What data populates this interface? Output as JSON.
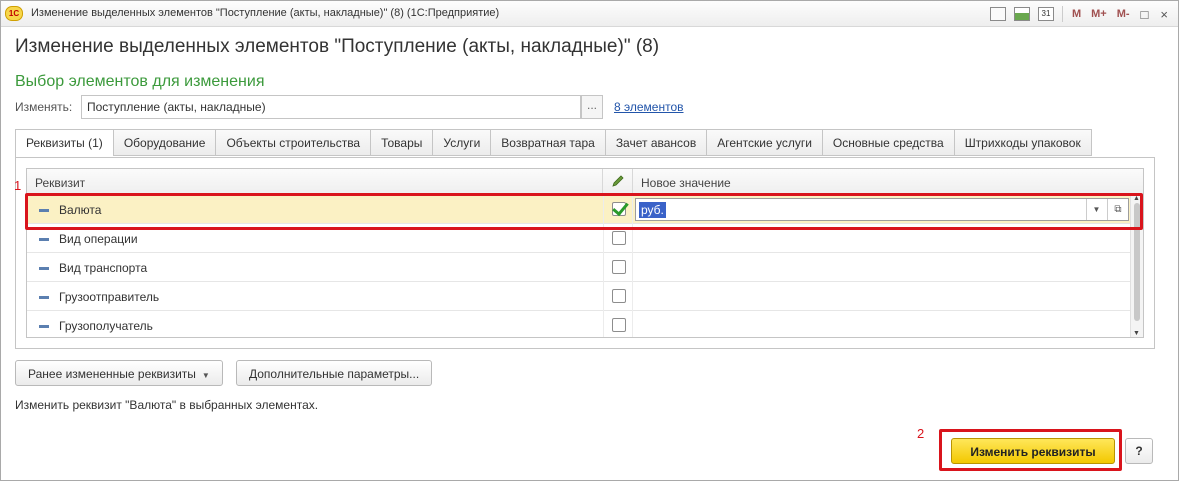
{
  "window": {
    "logo_text": "1С",
    "title": "Изменение выделенных элементов \"Поступление (акты, накладные)\" (8)  (1С:Предприятие)",
    "toolbar": {
      "m": "M",
      "m_plus": "M+",
      "m_minus": "M-",
      "calendar": "31",
      "restore": "□",
      "close": "×"
    }
  },
  "form": {
    "title": "Изменение выделенных элементов \"Поступление (акты, накладные)\" (8)",
    "section_title": "Выбор элементов для изменения",
    "change_label": "Изменять:",
    "change_value": "Поступление (акты, накладные)",
    "choose_button": "...",
    "count_link": "8 элементов"
  },
  "tabs": [
    {
      "label": "Реквизиты (1)",
      "active": true
    },
    {
      "label": "Оборудование"
    },
    {
      "label": "Объекты строительства"
    },
    {
      "label": "Товары"
    },
    {
      "label": "Услуги"
    },
    {
      "label": "Возвратная тара"
    },
    {
      "label": "Зачет авансов"
    },
    {
      "label": "Агентские услуги"
    },
    {
      "label": "Основные средства"
    },
    {
      "label": "Штрихкоды упаковок"
    }
  ],
  "table": {
    "headers": {
      "attribute": "Реквизит",
      "new_value": "Новое значение",
      "edit_icon": "pencil-icon"
    },
    "rows": [
      {
        "name": "Валюта",
        "checked": true,
        "value": "руб."
      },
      {
        "name": "Вид операции",
        "checked": false,
        "value": ""
      },
      {
        "name": "Вид транспорта",
        "checked": false,
        "value": ""
      },
      {
        "name": "Грузоотправитель",
        "checked": false,
        "value": ""
      },
      {
        "name": "Грузополучатель",
        "checked": false,
        "value": ""
      }
    ]
  },
  "buttons": {
    "previously_changed": "Ранее измененные реквизиты",
    "extra_params": "Дополнительные параметры...",
    "apply": "Изменить реквизиты",
    "help": "?"
  },
  "hint": "Изменить реквизит \"Валюта\" в выбранных элементах.",
  "annotations": {
    "first": "1",
    "second": "2"
  },
  "colors": {
    "highlight": "#d9141c",
    "selected_row": "#fbf1c4",
    "section_title": "#3c9a3c",
    "primary_button": "#f3c800"
  }
}
